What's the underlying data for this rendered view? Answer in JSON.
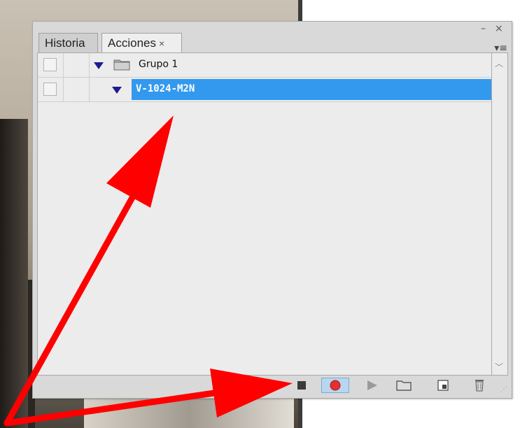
{
  "panel": {
    "tabs": [
      {
        "label": "Historia",
        "active": false
      },
      {
        "label": "Acciones",
        "active": true,
        "close": "×"
      }
    ],
    "minimize_glyph": "–",
    "close_glyph": "×",
    "menu_glyph": "▾≡"
  },
  "actions": {
    "rows": [
      {
        "label": "Grupo 1",
        "type": "set",
        "expanded": true
      },
      {
        "label": "V-1024-M2N",
        "type": "action",
        "expanded": true,
        "selected": true
      }
    ]
  },
  "toolbar": {
    "buttons": [
      {
        "name": "stop-icon"
      },
      {
        "name": "record-icon",
        "active": true
      },
      {
        "name": "play-icon"
      },
      {
        "name": "new-set-icon"
      },
      {
        "name": "new-action-icon"
      },
      {
        "name": "delete-icon"
      }
    ]
  },
  "colors": {
    "selection": "#3399ee",
    "annotation_arrow": "#ff0000",
    "record": "#e53030"
  }
}
